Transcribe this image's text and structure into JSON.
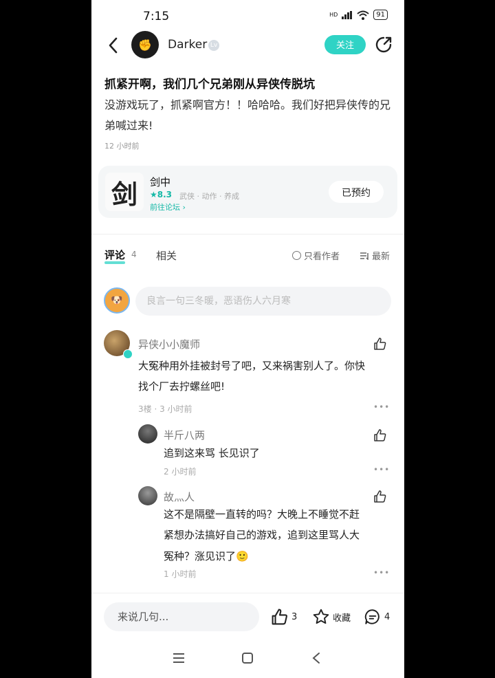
{
  "status": {
    "time": "7:15",
    "signal": "HD",
    "battery": "91"
  },
  "header": {
    "author": "Darker",
    "follow_label": "关注"
  },
  "post": {
    "title": "抓紧开啊，我们几个兄弟刚从异侠传脱坑",
    "body": "没游戏玩了，抓紧啊官方！！哈哈哈。我们好把异侠传的兄弟喊过来!",
    "time": "12 小时前"
  },
  "game": {
    "logo_char": "剑",
    "name": "剑中",
    "rating": "★8.3",
    "tags": "武侠 · 动作 · 养成",
    "forum_link": "前往论坛 ›",
    "reserve_label": "已预约"
  },
  "tabs": {
    "comments_label": "评论",
    "comments_count": "4",
    "related_label": "相关",
    "author_only_label": "只看作者",
    "latest_label": "最新"
  },
  "comment_input": {
    "placeholder": "良言一句三冬暖，恶语伤人六月寒"
  },
  "comments": [
    {
      "name": "异侠小小魔师",
      "text_line1": "大冤种用外挂被封号了吧，又来祸害别人了。你快",
      "text_line2": "找个厂去拧螺丝吧!",
      "meta": "3楼 · 3 小时前"
    }
  ],
  "replies": [
    {
      "name": "半斤八两",
      "text": "追到这来骂 长见识了",
      "meta": "2 小时前"
    },
    {
      "name": "故灬人",
      "text_line1": "这不是隔壁一直转的吗？大晚上不睡觉不赶",
      "text_line2": "紧想办法搞好自己的游戏，追到这里骂人大",
      "text_line3": "冤种？涨见识了🙂",
      "meta": "1 小时前"
    }
  ],
  "bottom_bar": {
    "say_placeholder": "来说几句...",
    "likes": "3",
    "favorite_label": "收藏",
    "comments": "4"
  },
  "icons": {
    "back": "chevron-left-icon",
    "share": "share-icon",
    "like": "thumbs-up-icon",
    "more": "more-dots-icon",
    "favorite": "star-icon",
    "comment": "comment-icon",
    "nav_menu": "menu-icon",
    "nav_home": "home-square-icon",
    "nav_back": "nav-back-icon"
  },
  "colors": {
    "accent": "#2fd3c5",
    "rating": "#14b8a6"
  }
}
